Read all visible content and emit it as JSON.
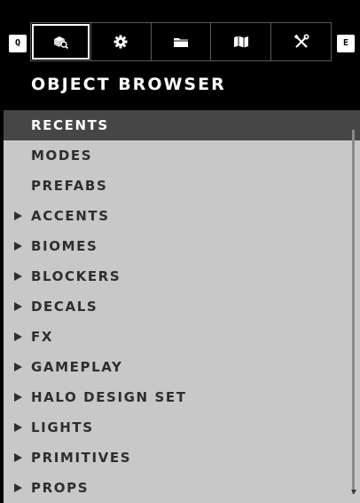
{
  "keys": {
    "left": "Q",
    "right": "E"
  },
  "tabs": [
    {
      "icon": "object-search-icon",
      "active": true
    },
    {
      "icon": "gear-icon",
      "active": false
    },
    {
      "icon": "folder-icon",
      "active": false
    },
    {
      "icon": "map-icon",
      "active": false
    },
    {
      "icon": "tools-icon",
      "active": false
    }
  ],
  "panel": {
    "title": "OBJECT BROWSER"
  },
  "categories": [
    {
      "label": "RECENTS",
      "expandable": false,
      "selected": true
    },
    {
      "label": "MODES",
      "expandable": false
    },
    {
      "label": "PREFABS",
      "expandable": false
    },
    {
      "label": "ACCENTS",
      "expandable": true
    },
    {
      "label": "BIOMES",
      "expandable": true
    },
    {
      "label": "BLOCKERS",
      "expandable": true
    },
    {
      "label": "DECALS",
      "expandable": true
    },
    {
      "label": "FX",
      "expandable": true
    },
    {
      "label": "GAMEPLAY",
      "expandable": true
    },
    {
      "label": "HALO DESIGN SET",
      "expandable": true
    },
    {
      "label": "LIGHTS",
      "expandable": true
    },
    {
      "label": "PRIMITIVES",
      "expandable": true
    },
    {
      "label": "PROPS",
      "expandable": true
    }
  ],
  "colors": {
    "header_bg": "#000000",
    "list_bg": "#c8c8c8",
    "selected_bg": "#464646",
    "text": "#2e2e2e"
  }
}
